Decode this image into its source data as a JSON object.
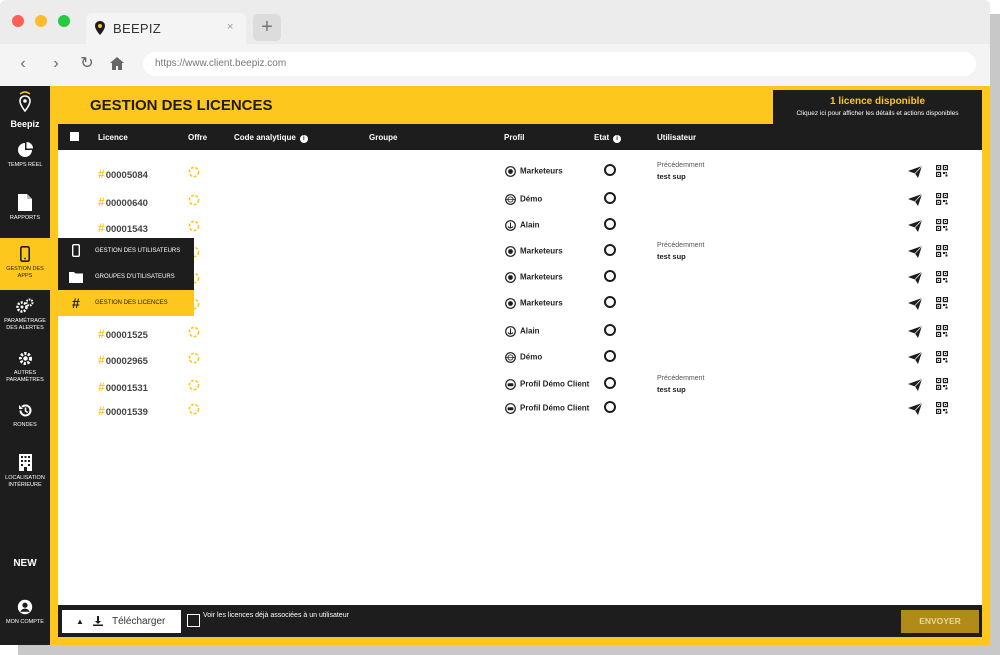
{
  "browser": {
    "tab_title": "BEEPIZ",
    "tab_close": "×",
    "new_tab": "+",
    "url": "https://www.client.beepiz.com"
  },
  "sidebar": {
    "logo_text": "Beepiz",
    "items": [
      {
        "label": "TEMPS RÉEL",
        "icon": "pie-chart-icon"
      },
      {
        "label": "RAPPORTS",
        "icon": "document-icon"
      },
      {
        "label": "GESTION DES APPS",
        "icon": "phone-icon"
      },
      {
        "label": "PARAMÉTRAGE DES ALERTES",
        "icon": "gears-icon"
      },
      {
        "label": "AUTRES PARAMÈTRES",
        "icon": "gear-icon"
      },
      {
        "label": "RONDES",
        "icon": "history-icon"
      },
      {
        "label": "LOCALISATION INTÉRIEURE",
        "icon": "building-icon"
      }
    ],
    "new_label": "NEW",
    "account_label": "MON COMPTE"
  },
  "submenu": {
    "items": [
      {
        "label": "GESTION DES UTILISATEURS"
      },
      {
        "label": "GROUPES D'UTILISATEURS"
      },
      {
        "label": "GESTION DES LICENCES"
      }
    ]
  },
  "header": {
    "title": "GESTION DES LICENCES",
    "license_box_title": "1 licence disponible",
    "license_box_subtitle": "Cliquez ici pour afficher les détails et actions disponibles"
  },
  "table": {
    "columns": {
      "licence": "Licence",
      "offre": "Offre",
      "code": "Code analytique",
      "groupe": "Groupe",
      "profil": "Profil",
      "etat": "Etat",
      "utilisateur": "Utilisateur"
    },
    "hash": "#",
    "previous_label": "Précédemment",
    "rows": [
      {
        "licence": "00005084",
        "profil": "Marketeurs",
        "profil_icon": "target-icon",
        "prev_user": "test sup"
      },
      {
        "licence": "00000640",
        "profil": "Démo",
        "profil_icon": "globe-icon",
        "prev_user": null
      },
      {
        "licence": "00001543",
        "profil": "Alain",
        "profil_icon": "anchor-icon",
        "prev_user": null
      },
      {
        "licence": "",
        "profil": "Marketeurs",
        "profil_icon": "target-icon",
        "prev_user": "test sup"
      },
      {
        "licence": "",
        "profil": "Marketeurs",
        "profil_icon": "target-icon",
        "prev_user": null
      },
      {
        "licence": "",
        "profil": "Marketeurs",
        "profil_icon": "target-icon",
        "prev_user": null
      },
      {
        "licence": "00001525",
        "profil": "Alain",
        "profil_icon": "anchor-icon",
        "prev_user": null
      },
      {
        "licence": "00002965",
        "profil": "Démo",
        "profil_icon": "globe-icon",
        "prev_user": null
      },
      {
        "licence": "00001531",
        "profil": "Profil Démo Client",
        "profil_icon": "car-icon",
        "prev_user": "test sup"
      },
      {
        "licence": "00001539",
        "profil": "Profil Démo Client",
        "profil_icon": "car-icon",
        "prev_user": null
      }
    ]
  },
  "footer": {
    "download_label": "Télécharger",
    "checkbox_label": "Voir les licences déjà associées à un utilisateur",
    "send_label": "ENVOYER"
  },
  "colors": {
    "accent": "#fec71d",
    "dark": "#1d1d1d",
    "send_disabled": "#b08b18"
  }
}
